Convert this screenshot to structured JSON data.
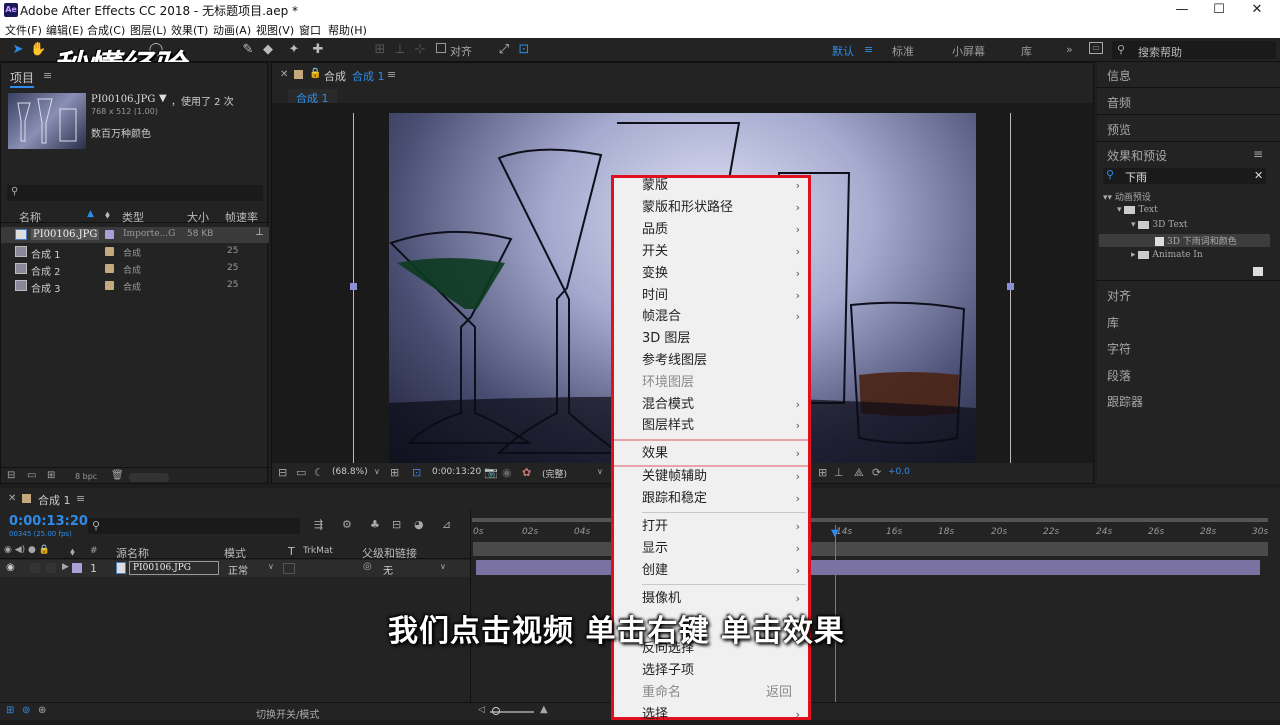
{
  "app": {
    "title": "Adobe After Effects CC 2018 - 无标题项目.aep *",
    "logo": "Ae"
  },
  "window_controls": {
    "minimize": "—",
    "maximize": "☐",
    "close": "✕"
  },
  "menu": [
    "文件(F)",
    "编辑(E)",
    "合成(C)",
    "图层(L)",
    "效果(T)",
    "动画(A)",
    "视图(V)",
    "窗口",
    "帮助(H)"
  ],
  "watermark": "秒懂经验",
  "toolbar": {
    "align_label": "对齐"
  },
  "workspaces": [
    "默认",
    "标准",
    "小屏幕",
    "库"
  ],
  "search_help": {
    "placeholder": "搜索帮助"
  },
  "project": {
    "tab": "项目",
    "file_name": "PI00106.JPG",
    "usage": "，使用了 2 次",
    "dims": "768 x 512 (1.00)",
    "colors": "数百万种颜色",
    "columns": [
      "名称",
      "类型",
      "大小",
      "帧速率"
    ],
    "items": [
      {
        "name": "PI00106.JPG",
        "type": "Importe...G",
        "size": "58 KB",
        "fps": ""
      },
      {
        "name": "合成 1",
        "type": "合成",
        "size": "",
        "fps": "25"
      },
      {
        "name": "合成 2",
        "type": "合成",
        "size": "",
        "fps": "25"
      },
      {
        "name": "合成 3",
        "type": "合成",
        "size": "",
        "fps": "25"
      }
    ],
    "bpc": "8 bpc"
  },
  "composition": {
    "tab_prefix": "合成",
    "tab_name": "合成 1",
    "breadcrumb": "合成 1",
    "zoom": "(68.8%)",
    "timecode": "0:00:13:20",
    "resolution": "(完整)",
    "exposure": "+0.0"
  },
  "right_panel": {
    "top_items": [
      "信息",
      "音频",
      "预览"
    ],
    "effects_title": "效果和预设",
    "effects_search": "下雨",
    "tree": [
      "动画预设",
      "Text",
      "3D Text",
      "3D 下雨词和颜色",
      "Animate In"
    ],
    "bottom_items": [
      "对齐",
      "库",
      "字符",
      "段落",
      "跟踪器"
    ]
  },
  "timeline": {
    "tab": "合成 1",
    "timecode": "0:00:13:20",
    "frames": "00345 (25.00 fps)",
    "columns": [
      "源名称",
      "模式",
      "T",
      "TrkMat",
      "父级和链接"
    ],
    "layer": {
      "index": "1",
      "name": "PI00106.JPG",
      "mode": "正常",
      "parent": "无"
    },
    "ticks": [
      "0s",
      "02s",
      "04s",
      "14s",
      "16s",
      "18s",
      "20s",
      "22s",
      "24s",
      "26s",
      "28s",
      "30s"
    ],
    "footer": "切换开关/模式"
  },
  "context_menu": {
    "items": [
      {
        "label": "蒙版",
        "sub": true
      },
      {
        "label": "蒙版和形状路径",
        "sub": true
      },
      {
        "label": "品质",
        "sub": true
      },
      {
        "label": "开关",
        "sub": true
      },
      {
        "label": "变换",
        "sub": true
      },
      {
        "label": "时间",
        "sub": true
      },
      {
        "label": "帧混合",
        "sub": true
      },
      {
        "label": "3D 图层",
        "sub": false
      },
      {
        "label": "参考线图层",
        "sub": false
      },
      {
        "label": "环境图层",
        "sub": false,
        "disabled": true
      },
      {
        "label": "混合模式",
        "sub": true
      },
      {
        "label": "图层样式",
        "sub": true
      },
      {
        "label": "效果",
        "sub": true
      },
      {
        "label": "关键帧辅助",
        "sub": true
      },
      {
        "label": "跟踪和稳定",
        "sub": true
      },
      {
        "label": "打开",
        "sub": true
      },
      {
        "label": "显示",
        "sub": true
      },
      {
        "label": "创建",
        "sub": true
      },
      {
        "label": "摄像机",
        "sub": true
      },
      {
        "label": "反向选择",
        "sub": false
      },
      {
        "label": "选择子项",
        "sub": false
      },
      {
        "label": "重命名",
        "sub": false,
        "disabled": true,
        "shortcut": "返回"
      },
      {
        "label": "选择",
        "sub": true
      }
    ]
  },
  "subtitle": "我们点击视频 单击右键 单击效果",
  "colors": {
    "accent": "#2d8ceb",
    "highlight_border": "#e0101e",
    "menu_bg": "#f0f0f0"
  }
}
